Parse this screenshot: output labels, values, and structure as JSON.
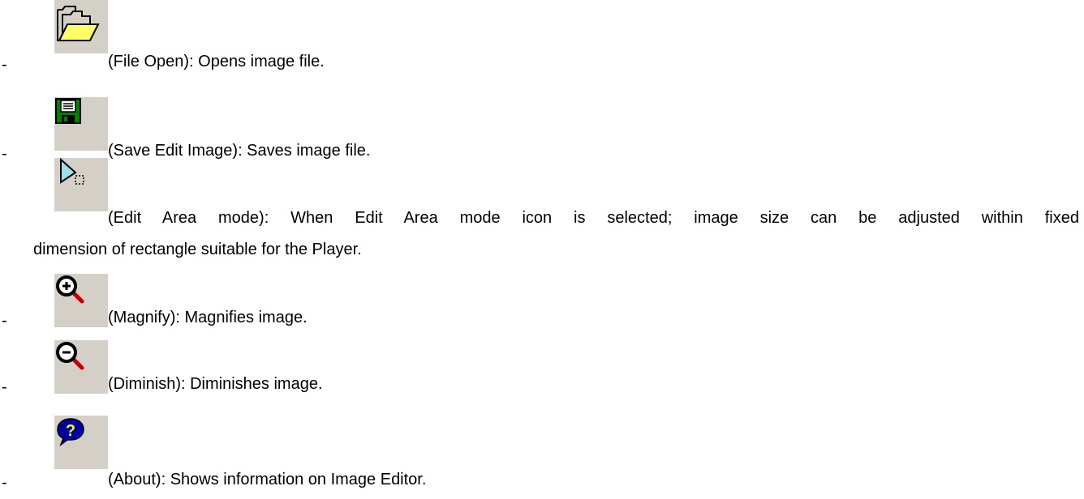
{
  "bullet": "-",
  "items": [
    {
      "name": "file-open",
      "icon": "folder-open-icon",
      "text": "(File Open): Opens image file."
    },
    {
      "name": "save-edit-image",
      "icon": "floppy-disk-icon",
      "text": "(Save Edit Image): Saves image file."
    },
    {
      "name": "edit-area-mode",
      "icon": "arrow-select-icon",
      "text": "(Edit Area mode): When Edit Area mode icon is selected; image size can be adjusted within fixed",
      "text_cont": "dimension of rectangle suitable for the Player."
    },
    {
      "name": "magnify",
      "icon": "zoom-in-icon",
      "text": "(Magnify): Magnifies image."
    },
    {
      "name": "diminish",
      "icon": "zoom-out-icon",
      "text": "(Diminish): Diminishes image."
    },
    {
      "name": "about",
      "icon": "help-bubble-icon",
      "text": "(About): Shows information on Image Editor."
    }
  ],
  "colors": {
    "button_face": "#d4d0c8",
    "folder_yellow": "#ffff66",
    "floppy_green": "#008000",
    "arrow_cyan": "#9fdfe6",
    "magnifier_red": "#c00000",
    "help_blue": "#0000a0",
    "help_yellow": "#ffff00"
  }
}
